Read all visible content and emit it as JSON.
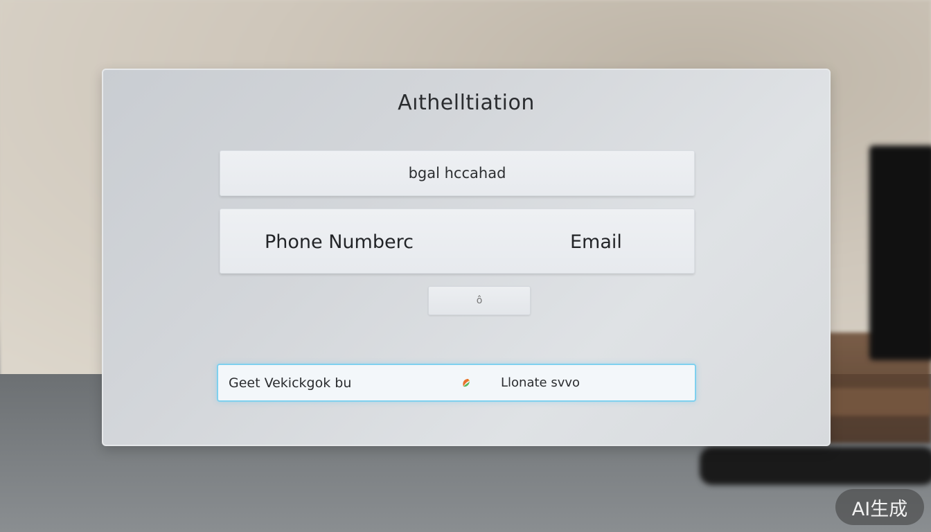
{
  "dialog": {
    "title": "Aıthelltiation",
    "top_field_text": "bgal hccahad",
    "toggle": {
      "phone_label": "Phone Numberc",
      "email_label": "Email"
    },
    "small_button_glyph": "ô",
    "actions": {
      "left_label": "Geet Vekickgok bu",
      "right_label": "Llonate svvo",
      "icon": "multicolor-leaf-icon"
    }
  },
  "watermark": "AI生成",
  "colors": {
    "accent_border": "#7fd0ee",
    "panel": "#d3d6da"
  }
}
